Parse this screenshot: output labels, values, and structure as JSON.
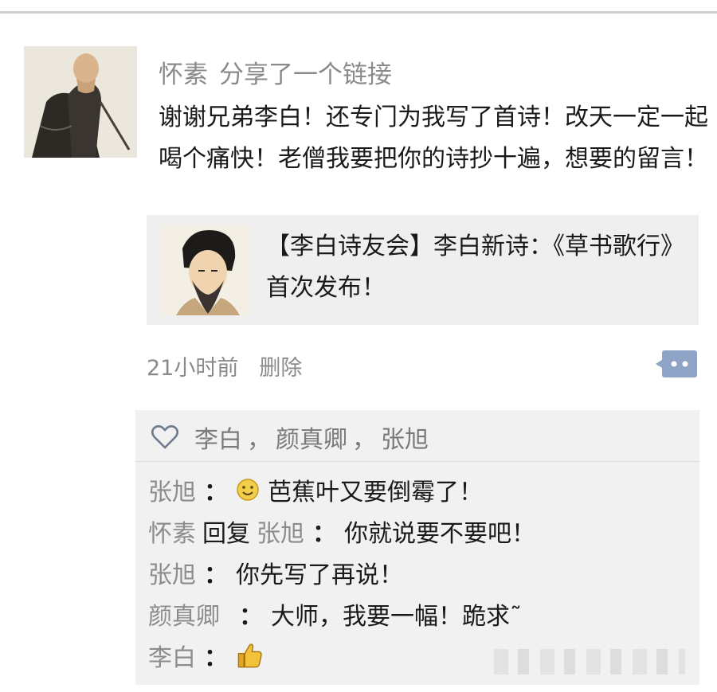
{
  "post": {
    "author": "怀素",
    "action": "分享了一个链接",
    "text": "谢谢兄弟李白！还专门为我写了首诗！改天一定一起喝个痛快！老僧我要把你的诗抄十遍，想要的留言！",
    "link_title": "【李白诗友会】李白新诗：《草书歌行》首次发布！",
    "time": "21小时前",
    "delete_label": "删除"
  },
  "likes": {
    "names": [
      "李白",
      "颜真卿",
      "张旭"
    ],
    "separator": "，"
  },
  "comments": [
    {
      "name": "张旭",
      "emoji": "smile-emoji",
      "text": "芭蕉叶又要倒霉了！"
    },
    {
      "name": "怀素",
      "reply_word": "回复",
      "reply_to": "张旭",
      "text": "你就说要不要吧！"
    },
    {
      "name": "张旭",
      "text": "你先写了再说！"
    },
    {
      "name": "颜真卿",
      "text": "大师，我要一幅！跪求˜"
    },
    {
      "name": "李白",
      "emoji": "thumbs-up-emoji",
      "text": ""
    }
  ],
  "colon": "：",
  "colors": {
    "name_gray": "#8c8c8c",
    "panel_bg": "#f1f1f1",
    "card_bg": "#efefef",
    "button_blue": "#8ea4c6"
  }
}
